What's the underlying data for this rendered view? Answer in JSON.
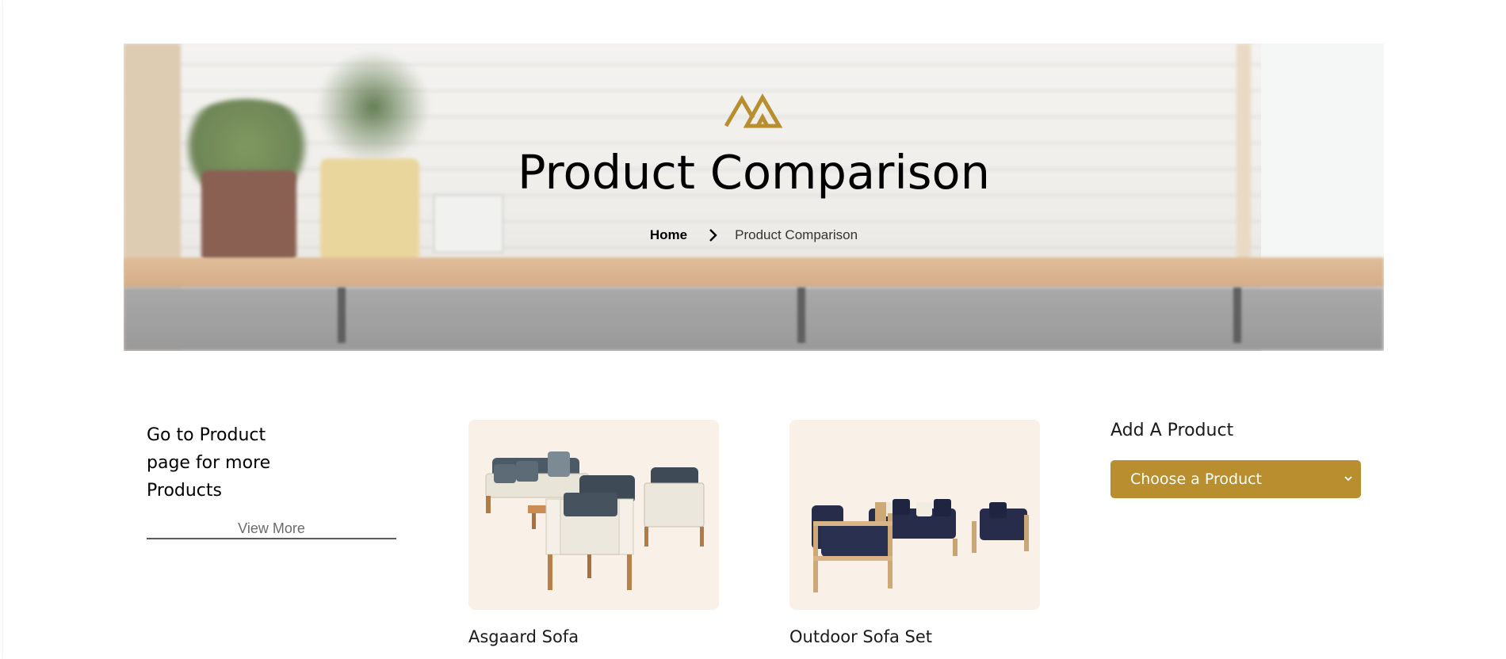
{
  "hero": {
    "title": "Product Comparison",
    "breadcrumb": {
      "home": "Home",
      "current": "Product Comparison"
    },
    "logo_icon": "brand-logo-icon"
  },
  "sidebar": {
    "goto_text": "Go to Product page for more Products",
    "view_more": "View More"
  },
  "products": [
    {
      "name": "Asgaard Sofa",
      "image": "outdoor-sofa-set-grey-icon"
    },
    {
      "name": "Outdoor Sofa Set",
      "image": "outdoor-sofa-set-navy-icon"
    }
  ],
  "add_product": {
    "title": "Add A Product",
    "select_value": "Choose a Product"
  },
  "colors": {
    "accent": "#b88e2f",
    "card_bg": "#f9f1e7"
  }
}
